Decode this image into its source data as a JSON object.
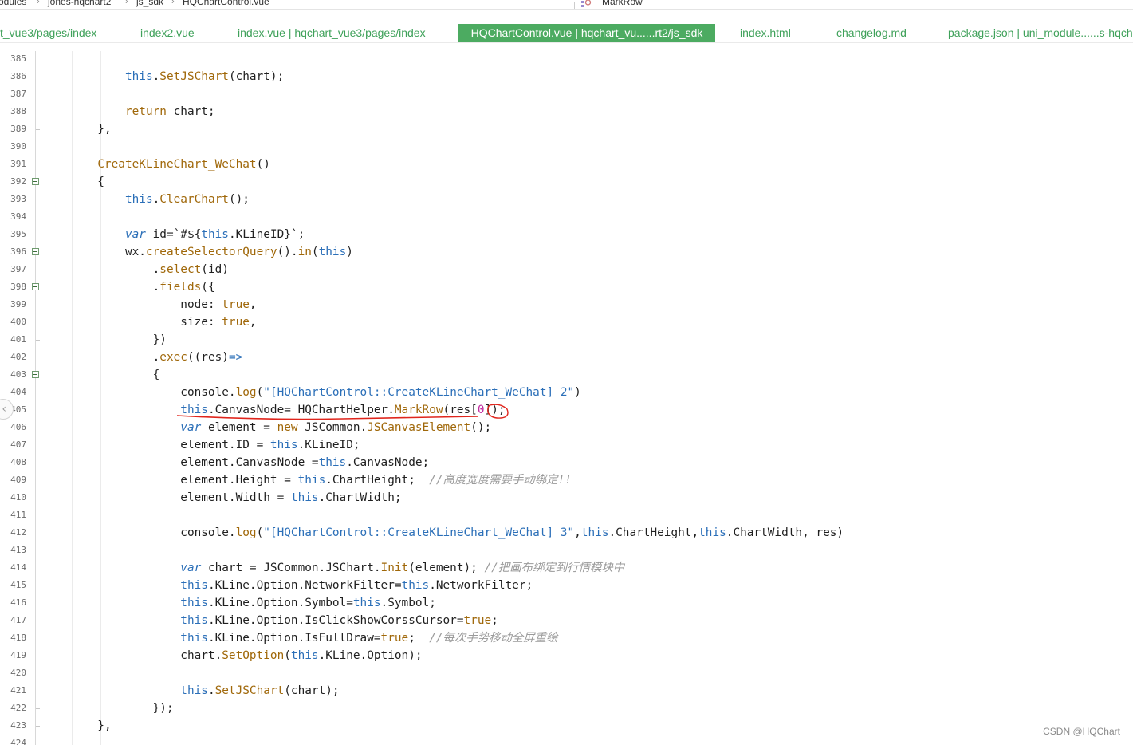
{
  "breadcrumb": {
    "items": [
      "odules",
      "jones-hqchart2",
      "js_sdk",
      "HQChartControl.vue"
    ],
    "search_text": "MarkRow"
  },
  "tabs": [
    {
      "label": "t_vue3/pages/index",
      "active": false
    },
    {
      "label": "index2.vue",
      "active": false
    },
    {
      "label": "index.vue | hqchart_vue3/pages/index",
      "active": false
    },
    {
      "label": "HQChartControl.vue | hqchart_vu......rt2/js_sdk",
      "active": true
    },
    {
      "label": "index.html",
      "active": false
    },
    {
      "label": "changelog.md",
      "active": false
    },
    {
      "label": "package.json | uni_module......s-hqchar",
      "active": false
    }
  ],
  "editor": {
    "lines": [
      {
        "n": "385",
        "t": ""
      },
      {
        "n": "386",
        "t": "            <k>this</k>.<f>SetJSChart</f>(chart);"
      },
      {
        "n": "387",
        "t": ""
      },
      {
        "n": "388",
        "t": "            <f>return</f> chart;"
      },
      {
        "n": "389",
        "t": "        },"
      },
      {
        "n": "390",
        "t": ""
      },
      {
        "n": "391",
        "t": "        <f>CreateKLineChart_WeChat</f>()"
      },
      {
        "n": "392",
        "t": "        {",
        "fold": true
      },
      {
        "n": "393",
        "t": "            <k>this</k>.<f>ClearChart</f>();"
      },
      {
        "n": "394",
        "t": ""
      },
      {
        "n": "395",
        "t": "            <i>var</i> id=`#${<k>this</k>.KLineID}`;"
      },
      {
        "n": "396",
        "t": "            wx.<f>createSelectorQuery</f>().<f>in</f>(<k>this</k>)",
        "fold": true
      },
      {
        "n": "397",
        "t": "                .<f>select</f>(id)"
      },
      {
        "n": "398",
        "t": "                .<f>fields</f>({",
        "fold": true
      },
      {
        "n": "399",
        "t": "                    node: <f>true</f>,"
      },
      {
        "n": "400",
        "t": "                    size: <f>true</f>,"
      },
      {
        "n": "401",
        "t": "                })"
      },
      {
        "n": "402",
        "t": "                .<f>exec</f>((res)<k>=></k>"
      },
      {
        "n": "403",
        "t": "                {",
        "fold": true
      },
      {
        "n": "404",
        "t": "                    console.<f>log</f>(<s>\"[HQChartControl::CreateKLineChart_WeChat] 2\"</s>)"
      },
      {
        "n": "405",
        "t": "                    <k>this</k>.CanvasNode= HQChartHelper.<f>MarkRow</f>(res[<n>0</n>]);"
      },
      {
        "n": "406",
        "t": "                    <i>var</i> element = <f>new</f> JSCommon.<f>JSCanvasElement</f>();"
      },
      {
        "n": "407",
        "t": "                    element.ID = <k>this</k>.KLineID;"
      },
      {
        "n": "408",
        "t": "                    element.CanvasNode =<k>this</k>.CanvasNode;"
      },
      {
        "n": "409",
        "t": "                    element.Height = <k>this</k>.ChartHeight;  <c>//高度宽度需要手动绑定!!</c>"
      },
      {
        "n": "410",
        "t": "                    element.Width = <k>this</k>.ChartWidth;"
      },
      {
        "n": "411",
        "t": ""
      },
      {
        "n": "412",
        "t": "                    console.<f>log</f>(<s>\"[HQChartControl::CreateKLineChart_WeChat] 3\"</s>,<k>this</k>.ChartHeight,<k>this</k>.ChartWidth, res)"
      },
      {
        "n": "413",
        "t": ""
      },
      {
        "n": "414",
        "t": "                    <i>var</i> chart = JSCommon.JSChart.<f>Init</f>(element); <c>//把画布绑定到行情模块中</c>"
      },
      {
        "n": "415",
        "t": "                    <k>this</k>.KLine.Option.NetworkFilter=<k>this</k>.NetworkFilter;"
      },
      {
        "n": "416",
        "t": "                    <k>this</k>.KLine.Option.Symbol=<k>this</k>.Symbol;"
      },
      {
        "n": "417",
        "t": "                    <k>this</k>.KLine.Option.IsClickShowCorssCursor=<f>true</f>;"
      },
      {
        "n": "418",
        "t": "                    <k>this</k>.KLine.Option.IsFullDraw=<f>true</f>;  <c>//每次手势移动全屏重绘</c>"
      },
      {
        "n": "419",
        "t": "                    chart.<f>SetOption</f>(<k>this</k>.KLine.Option);"
      },
      {
        "n": "420",
        "t": ""
      },
      {
        "n": "421",
        "t": "                    <k>this</k>.<f>SetJSChart</f>(chart);"
      },
      {
        "n": "422",
        "t": "                });"
      },
      {
        "n": "423",
        "t": "        },"
      },
      {
        "n": "424",
        "t": ""
      }
    ]
  },
  "watermark": "CSDN @HQChart",
  "colors": {
    "active_tab_bg": "#4cab61",
    "tab_text": "#3fa15a",
    "keyword": "#2b6fb8",
    "function": "#a0680a",
    "comment": "#9a9a9a",
    "annotation": "#e0251c"
  }
}
